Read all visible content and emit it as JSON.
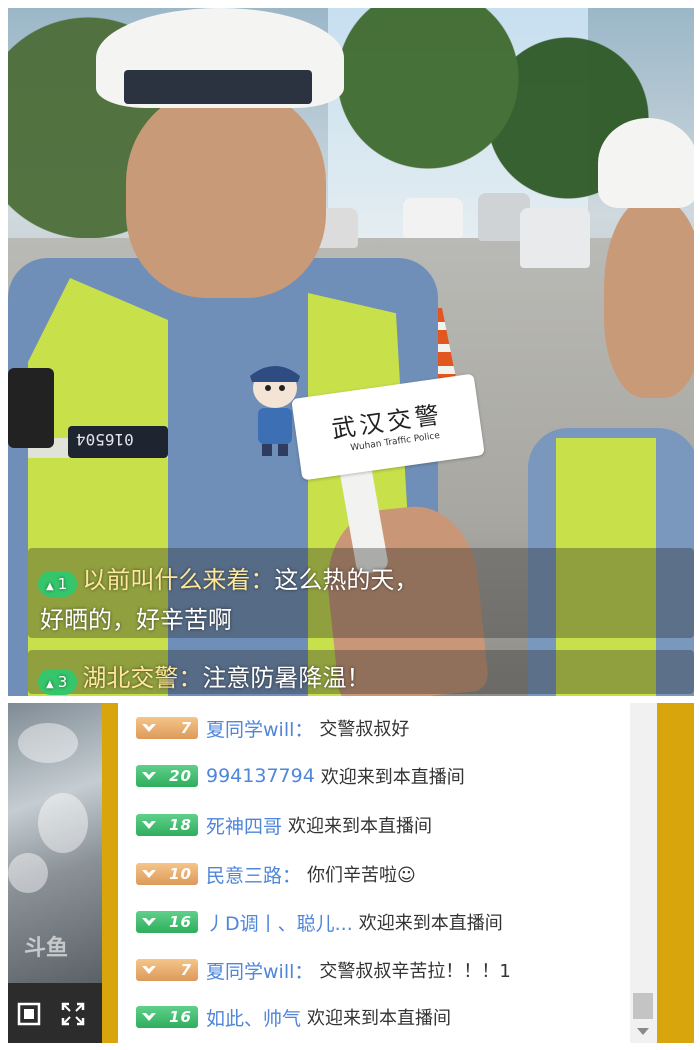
{
  "video": {
    "mic_card_text": "武汉交警",
    "mic_card_sub": "Wuhan Traffic Police",
    "badge_number": "016504",
    "danmu": [
      {
        "level": "1",
        "user": "以前叫什么来着：",
        "message": "这么热的天，",
        "message_line2": "好晒的，好辛苦啊"
      },
      {
        "level": "3",
        "user": "湖北交警：",
        "message": "注意防暑降温！"
      }
    ]
  },
  "mini_player": {
    "logo": "斗鱼",
    "fullscreen_icon": "fullscreen-icon",
    "expand_icon": "expand-icon"
  },
  "chat": [
    {
      "badge_type": "gold",
      "level": "7",
      "name": "夏同学will：",
      "message": "交警叔叔好"
    },
    {
      "badge_type": "green",
      "level": "20",
      "name": "994137794",
      "message": "欢迎来到本直播间"
    },
    {
      "badge_type": "green",
      "level": "18",
      "name": "死神四哥",
      "message": "欢迎来到本直播间"
    },
    {
      "badge_type": "gold",
      "level": "10",
      "name": "民意三路：",
      "message": "你们辛苦啦☺"
    },
    {
      "badge_type": "green",
      "level": "16",
      "name": "丿D调丨、聪儿...",
      "message": "欢迎来到本直播间"
    },
    {
      "badge_type": "gold",
      "level": "7",
      "name": "夏同学will：",
      "message": "交警叔叔辛苦拉！！！1"
    },
    {
      "badge_type": "green",
      "level": "16",
      "name": "如此、帅气",
      "message": "欢迎来到本直播间"
    }
  ],
  "colors": {
    "accent_gold": "#d9a50c",
    "level_green": "#35c56b",
    "name_blue": "#4f86d9"
  }
}
